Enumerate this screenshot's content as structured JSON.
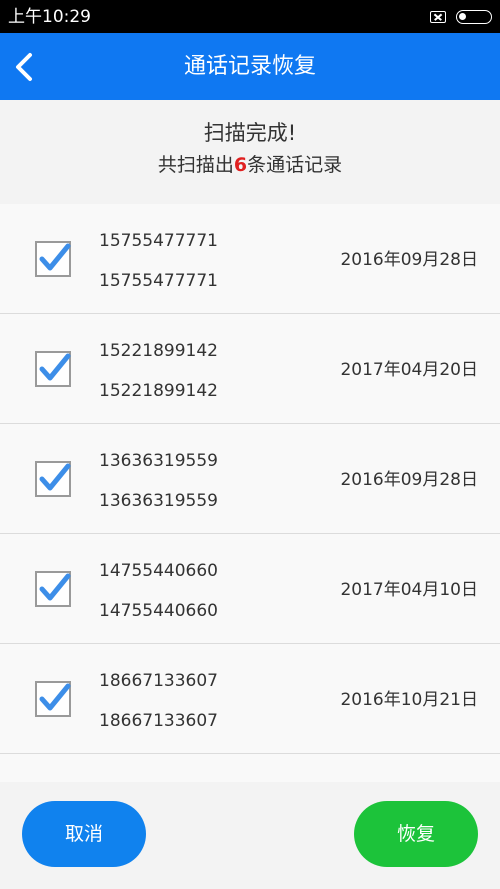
{
  "status_bar": {
    "time": "上午10:29",
    "icons": [
      "sim-missing-icon",
      "battery-icon"
    ]
  },
  "header": {
    "back_icon": "chevron-left-icon",
    "title": "通话记录恢复"
  },
  "summary": {
    "title": "扫描完成!",
    "prefix": "共扫描出",
    "count": "6",
    "suffix": "条通话记录"
  },
  "records": [
    {
      "number": "15755477771",
      "name": "15755477771",
      "date": "2016年09月28日",
      "checked": true
    },
    {
      "number": "15221899142",
      "name": "15221899142",
      "date": "2017年04月20日",
      "checked": true
    },
    {
      "number": "13636319559",
      "name": "13636319559",
      "date": "2016年09月28日",
      "checked": true
    },
    {
      "number": "14755440660",
      "name": "14755440660",
      "date": "2017年04月10日",
      "checked": true
    },
    {
      "number": "18667133607",
      "name": "18667133607",
      "date": "2016年10月21日",
      "checked": true
    }
  ],
  "buttons": {
    "cancel_label": "取消",
    "restore_label": "恢复"
  },
  "colors": {
    "accent": "#0f78f2",
    "cancel": "#1082ee",
    "restore": "#1cc33a",
    "count": "#e02020",
    "check": "#3d8ee8"
  }
}
